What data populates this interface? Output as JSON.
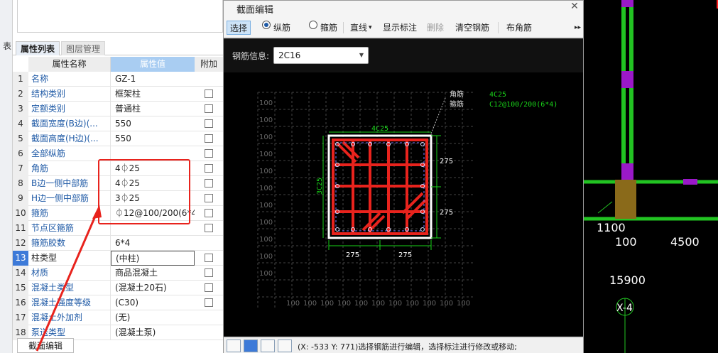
{
  "left_strip": {
    "char": "表"
  },
  "panel": {
    "tabs": [
      "属性列表",
      "图层管理"
    ],
    "headers": {
      "name": "属性名称",
      "value": "属性值",
      "add": "附加"
    },
    "rows": [
      {
        "num": "1",
        "name": "名称",
        "value": "GZ-1",
        "check": false
      },
      {
        "num": "2",
        "name": "结构类别",
        "value": "框架柱",
        "check": true
      },
      {
        "num": "3",
        "name": "定额类别",
        "value": "普通柱",
        "check": true
      },
      {
        "num": "4",
        "name": "截面宽度(B边)(...",
        "value": "550",
        "check": true
      },
      {
        "num": "5",
        "name": "截面高度(H边)(...",
        "value": "550",
        "check": true
      },
      {
        "num": "6",
        "name": "全部纵筋",
        "value": "",
        "check": true
      },
      {
        "num": "7",
        "name": "角筋",
        "value": "4⏀25",
        "check": true
      },
      {
        "num": "8",
        "name": "B边一侧中部筋",
        "value": "4⏀25",
        "check": true
      },
      {
        "num": "9",
        "name": "H边一侧中部筋",
        "value": "3⏀25",
        "check": true
      },
      {
        "num": "10",
        "name": "箍筋",
        "value": "⏀12@100/200(6*4)",
        "check": true
      },
      {
        "num": "11",
        "name": "节点区箍筋",
        "value": "",
        "check": true
      },
      {
        "num": "12",
        "name": "箍筋胶数",
        "value": "6*4",
        "check": false
      },
      {
        "num": "13",
        "name": "柱类型",
        "value": "(中柱)",
        "check": true,
        "selected": true
      },
      {
        "num": "14",
        "name": "材质",
        "value": "商品混凝土",
        "check": true
      },
      {
        "num": "15",
        "name": "混凝土类型",
        "value": "(混凝土20石)",
        "check": true
      },
      {
        "num": "16",
        "name": "混凝土强度等级",
        "value": "(C30)",
        "check": true
      },
      {
        "num": "17",
        "name": "混凝土外加剂",
        "value": "(无)",
        "check": false
      },
      {
        "num": "18",
        "name": "泵送类型",
        "value": "(混凝土泵)",
        "check": false
      }
    ],
    "bottom_tab": "截面编辑"
  },
  "dialog": {
    "title": "截面编辑",
    "close": "✕",
    "toolbar": {
      "select": "选择",
      "longitudinal": "纵筋",
      "stirrup": "箍筋",
      "line": "直线",
      "line_caret": "▾",
      "show_label": "显示标注",
      "delete": "删除",
      "clear": "清空钢筋",
      "corner": "布角筋",
      "more": "▸▸"
    },
    "rebar_info": {
      "label": "钢筋信息:",
      "value": "2C16"
    },
    "status_text": "(X: -533 Y: 771)选择钢筋进行编辑，选择标注进行修改或移动;"
  },
  "drawing": {
    "corner_label": "角筋",
    "stirrup_label": "箍筋",
    "legend_corner": "4C25",
    "legend_stirrup": "C12@100/200(6*4)",
    "top_rebar": "4C25",
    "side_rebar": "3C25",
    "dim_right_1": "275",
    "dim_right_2": "275",
    "dim_bottom_1": "275",
    "dim_bottom_2": "275",
    "grid_label": "100"
  },
  "background_cad": {
    "labels": [
      "1100",
      "100",
      "4500",
      "15900",
      "X-4"
    ]
  }
}
